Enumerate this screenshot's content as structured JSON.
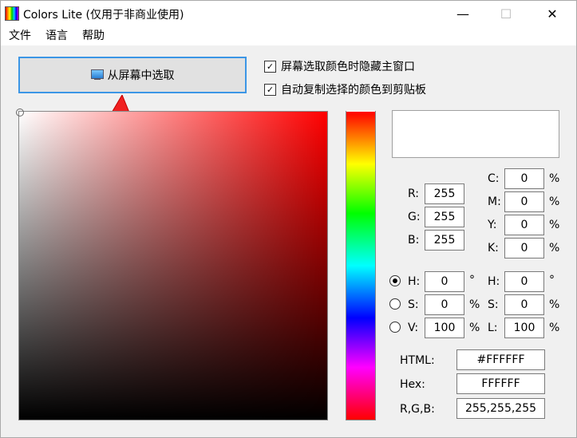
{
  "window": {
    "title": "Colors Lite (仅用于非商业使用)",
    "minimize_glyph": "—",
    "maximize_glyph": "☐",
    "close_glyph": "✕"
  },
  "menu": {
    "items": [
      "文件",
      "语言",
      "帮助"
    ]
  },
  "toolbar": {
    "pick_button_label": "从屏幕中选取",
    "option_hide_window": "屏幕选取颜色时隐藏主窗口",
    "option_hide_window_checked": true,
    "option_auto_copy": "自动复制选择的颜色到剪贴板",
    "option_auto_copy_checked": true
  },
  "colors": {
    "accent": "#3c96e6",
    "arrow": "#f02020",
    "current": "#FFFFFF"
  },
  "checkmark": "✓",
  "rgb": {
    "r_label": "R:",
    "r_value": "255",
    "g_label": "G:",
    "g_value": "255",
    "b_label": "B:",
    "b_value": "255"
  },
  "cmyk": {
    "c_label": "C:",
    "c_value": "0",
    "m_label": "M:",
    "m_value": "0",
    "y_label": "Y:",
    "y_value": "0",
    "k_label": "K:",
    "k_value": "0",
    "unit": "%"
  },
  "hsv": {
    "h_label": "H:",
    "h_value": "0",
    "h_unit": "°",
    "h_selected": true,
    "s_label": "S:",
    "s_value": "0",
    "s_unit": "%",
    "v_label": "V:",
    "v_value": "100",
    "v_unit": "%"
  },
  "hsl": {
    "h_label": "H:",
    "h_value": "0",
    "h_unit": "°",
    "s_label": "S:",
    "s_value": "0",
    "s_unit": "%",
    "l_label": "L:",
    "l_value": "100",
    "l_unit": "%"
  },
  "codes": {
    "html_label": "HTML:",
    "html_value": "#FFFFFF",
    "hex_label": "Hex:",
    "hex_value": "FFFFFF",
    "rgb_label": "R,G,B:",
    "rgb_value": "255,255,255"
  }
}
